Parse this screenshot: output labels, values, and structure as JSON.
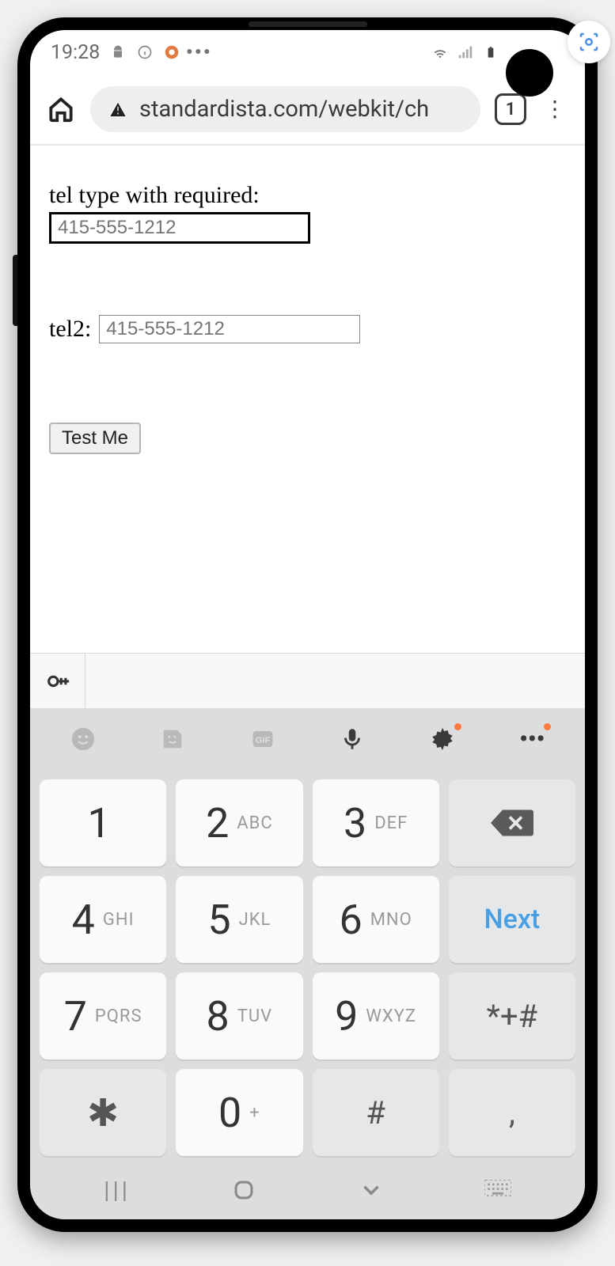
{
  "statusbar": {
    "time": "19:28",
    "icons": [
      "android-icon",
      "info-icon",
      "browser-icon",
      "more-icon"
    ],
    "right_icons": [
      "wifi-icon",
      "signal-icon",
      "battery-icon"
    ]
  },
  "browser": {
    "url": "standardista.com/webkit/ch",
    "tab_count": "1"
  },
  "page": {
    "label1": "tel type with required:",
    "input1_placeholder": "415-555-1212",
    "label2": "tel2:",
    "input2_placeholder": "415-555-1212",
    "button_label": "Test Me"
  },
  "keyboard": {
    "toolbar": [
      "emoji-icon",
      "sticker-icon",
      "gif-icon",
      "mic-icon",
      "settings-icon",
      "more-icon"
    ],
    "keys": [
      {
        "d": "1",
        "l": ""
      },
      {
        "d": "2",
        "l": "ABC"
      },
      {
        "d": "3",
        "l": "DEF"
      },
      {
        "type": "backspace"
      },
      {
        "d": "4",
        "l": "GHI"
      },
      {
        "d": "5",
        "l": "JKL"
      },
      {
        "d": "6",
        "l": "MNO"
      },
      {
        "type": "next",
        "label": "Next"
      },
      {
        "d": "7",
        "l": "PQRS"
      },
      {
        "d": "8",
        "l": "TUV"
      },
      {
        "d": "9",
        "l": "WXYZ"
      },
      {
        "type": "sym",
        "d": "*+#"
      },
      {
        "type": "sym",
        "d": "✱"
      },
      {
        "d": "0",
        "l": "+"
      },
      {
        "type": "sym",
        "d": "#"
      },
      {
        "type": "sym",
        "d": ","
      }
    ]
  },
  "navbar": [
    "recents",
    "home",
    "back",
    "keyboard-switch"
  ]
}
